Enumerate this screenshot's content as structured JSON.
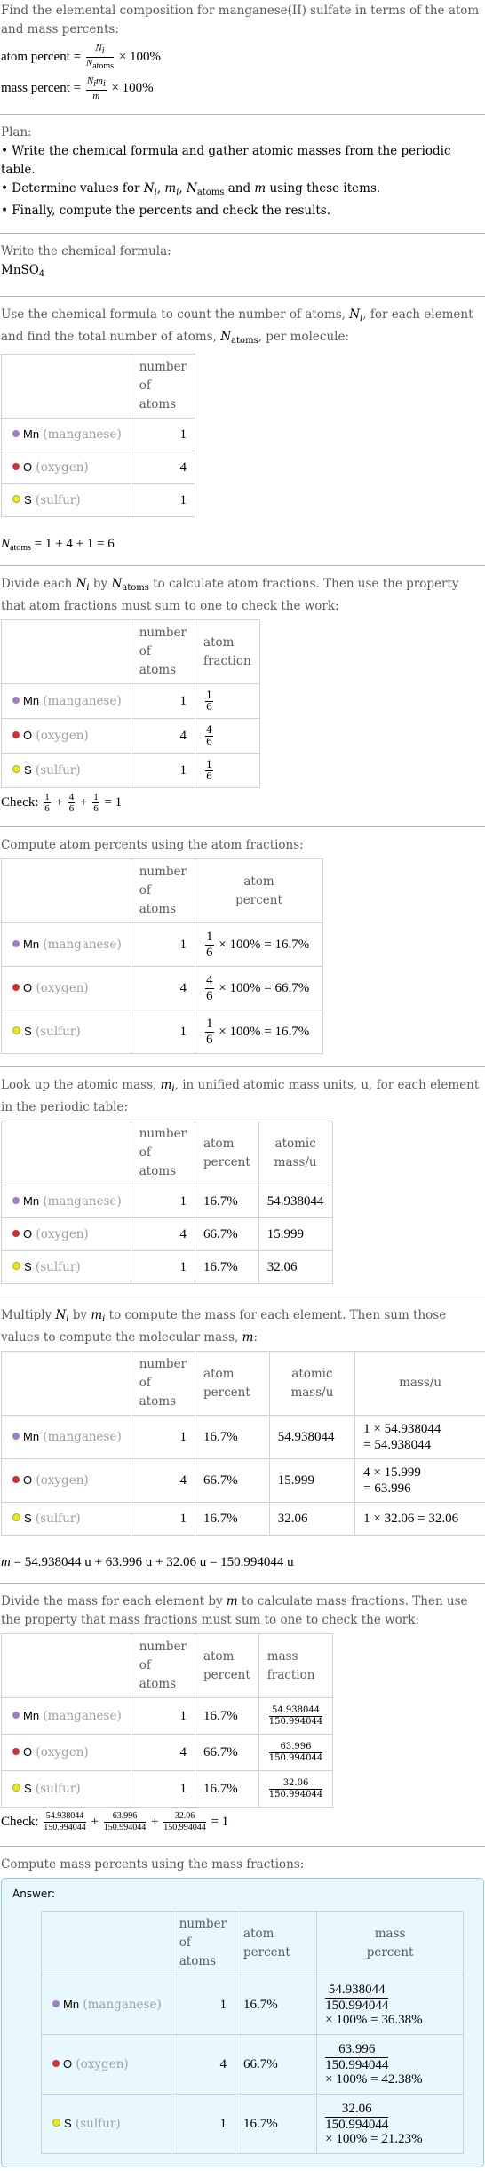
{
  "intro": {
    "text": "Find the elemental composition for manganese(II) sulfate in terms of the atom and mass percents:",
    "atom_percent_label": "atom percent =",
    "mass_percent_label": "mass percent =",
    "times_100": "× 100%"
  },
  "plan": {
    "title": "Plan:",
    "bullets": [
      "Write the chemical formula and gather atomic masses from the periodic table.",
      "Determine values for N_i, m_i, N_atoms and m using these items.",
      "Finally, compute the percents and check the results."
    ]
  },
  "formula_section": {
    "label": "Write the chemical formula:",
    "formula_base": "MnSO",
    "formula_sub": "4"
  },
  "count_section": {
    "text_a": "Use the chemical formula to count the number of atoms, ",
    "text_b": ", for each element and find the total number of atoms, ",
    "text_c": ", per molecule:",
    "total_line": "= 1 + 4 + 1 = 6"
  },
  "headers": {
    "number_of_atoms": [
      "number",
      "of atoms"
    ],
    "atom_fraction": [
      "atom",
      "fraction"
    ],
    "atom_percent": [
      "atom",
      "percent"
    ],
    "atomic_mass": [
      "atomic",
      "mass/u"
    ],
    "mass_u": "mass/u",
    "mass_fraction": [
      "mass",
      "fraction"
    ],
    "mass_percent": [
      "mass",
      "percent"
    ]
  },
  "elements": [
    {
      "symbol": "Mn",
      "name": "(manganese)",
      "color": "#9e7fc6",
      "count": "1",
      "fraction_num": "1",
      "fraction_den": "6",
      "atom_percent": "16.7%",
      "atomic_mass": "54.938044",
      "mass_calc_a": "1 × 54.938044",
      "mass_calc_b": "= 54.938044",
      "mass": "54.938044",
      "mass_percent": "36.38%"
    },
    {
      "symbol": "O",
      "name": "(oxygen)",
      "color": "#cc3333",
      "count": "4",
      "fraction_num": "4",
      "fraction_den": "6",
      "atom_percent": "66.7%",
      "atomic_mass": "15.999",
      "mass_calc_a": "4 × 15.999",
      "mass_calc_b": "= 63.996",
      "mass": "63.996",
      "mass_percent": "42.38%"
    },
    {
      "symbol": "S",
      "name": "(sulfur)",
      "color": "#e5e82a",
      "count": "1",
      "fraction_num": "1",
      "fraction_den": "6",
      "atom_percent": "16.7%",
      "atomic_mass": "32.06",
      "mass_calc_a": "1 × 32.06 = 32.06",
      "mass_calc_b": "",
      "mass": "32.06",
      "mass_percent": "21.23%"
    }
  ],
  "fraction_section": {
    "text": "to calculate atom fractions. Then use the property that atom fractions must sum to one to check the work:",
    "check_label": "Check:",
    "check_result": "= 1"
  },
  "atom_percent_section": {
    "text": "Compute atom percents using the atom fractions:"
  },
  "atomic_mass_section": {
    "text_a": "Look up the atomic mass, ",
    "text_b": ", in unified atomic mass units, u, for each element in the periodic table:"
  },
  "mass_section": {
    "text_a": "Multiply ",
    "text_b": " by ",
    "text_c": " to compute the mass for each element. Then sum those values to compute the molecular mass, ",
    "text_d": ":",
    "total": "= 54.938044 u + 63.996 u + 32.06 u = 150.994044 u"
  },
  "mass_fraction_section": {
    "text_a": "Divide the mass for each element by ",
    "text_b": " to calculate mass fractions. Then use the property that mass fractions must sum to one to check the work:",
    "denominator": "150.994044",
    "check_label": "Check:",
    "check_result": "= 1"
  },
  "mass_percent_section": {
    "text": "Compute mass percents using the mass fractions:",
    "answer_label": "Answer:",
    "times_100": "× 100% ="
  }
}
